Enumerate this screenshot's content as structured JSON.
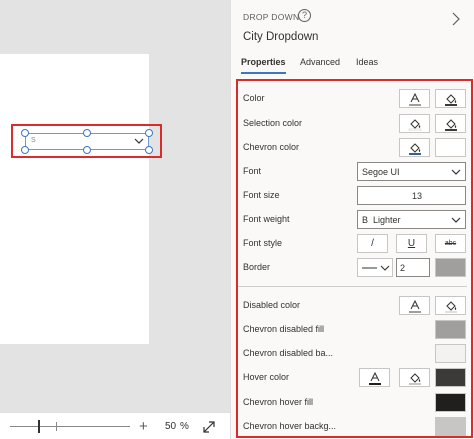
{
  "canvas": {
    "dropdown_value": "S"
  },
  "zoom": {
    "plus": "+",
    "value": "50",
    "unit": "%"
  },
  "panel": {
    "control_type": "DROP DOWN",
    "help": "?",
    "control_name": "City Dropdown",
    "tabs": [
      {
        "label": "Properties",
        "active": true
      },
      {
        "label": "Advanced",
        "active": false
      },
      {
        "label": "Ideas",
        "active": false
      }
    ]
  },
  "properties": {
    "color": {
      "label": "Color"
    },
    "selection_color": {
      "label": "Selection color"
    },
    "chevron_color": {
      "label": "Chevron color",
      "value_color": "#ffffff"
    },
    "font": {
      "label": "Font",
      "value": "Segoe UI"
    },
    "font_size": {
      "label": "Font size",
      "value": "13"
    },
    "font_weight": {
      "label": "Font weight",
      "value": "Lighter",
      "icon_letter": "B"
    },
    "font_style": {
      "label": "Font style",
      "italic": "/",
      "underline": "U",
      "strikethrough": "abc"
    },
    "border": {
      "label": "Border",
      "width": "2",
      "color": "#a19f9d"
    },
    "disabled_color": {
      "label": "Disabled color"
    },
    "chevron_disabled_fill": {
      "label": "Chevron disabled fill",
      "color": "#a19f9d"
    },
    "chevron_disabled_background": {
      "label": "Chevron disabled ba...",
      "color": "#f3f2f1"
    },
    "hover_color": {
      "label": "Hover color",
      "color": "#3b3a39"
    },
    "chevron_hover_fill": {
      "label": "Chevron hover fill",
      "color": "#201f1e"
    },
    "chevron_hover_background": {
      "label": "Chevron hover backg...",
      "color": "#c8c6c4"
    }
  },
  "colors": {
    "accent": "#3a78c3",
    "highlight": "#d92d2d"
  }
}
